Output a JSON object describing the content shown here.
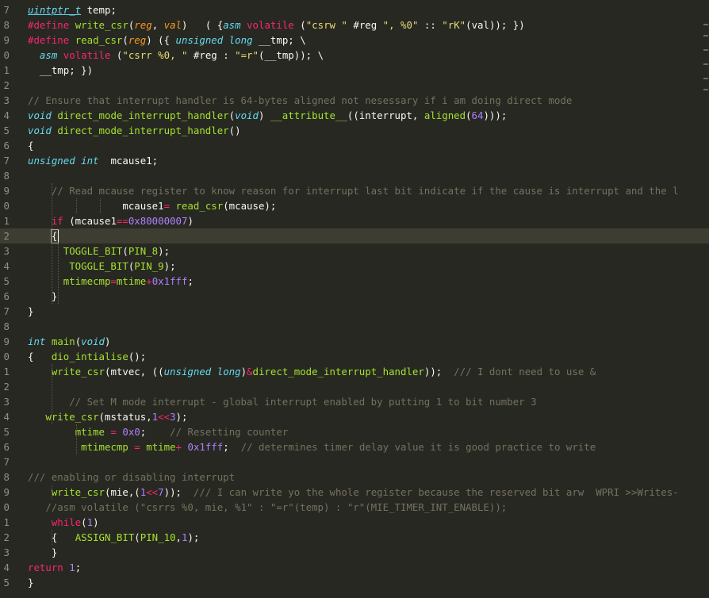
{
  "editor": {
    "theme_background": "#272822",
    "active_line_background": "#3e3d32",
    "colors": {
      "keyword": "#f92672",
      "type": "#66d9ef",
      "function": "#a6e22e",
      "string": "#e6db74",
      "number": "#ae81ff",
      "comment": "#75715e",
      "parameter": "#fd971f",
      "plain": "#f8f8f2"
    },
    "active_line_number": "21",
    "lines": [
      {
        "num": "7",
        "tokens": [
          [
            "t u",
            "uintptr_t"
          ],
          [
            "",
            " temp;"
          ]
        ]
      },
      {
        "num": "8",
        "tokens": [
          [
            "k",
            "#define"
          ],
          [
            "",
            " "
          ],
          [
            "f",
            "write_csr"
          ],
          [
            "",
            "("
          ],
          [
            "p",
            "reg"
          ],
          [
            "",
            ", "
          ],
          [
            "p",
            "val"
          ],
          [
            "",
            ")   ( {"
          ],
          [
            "t",
            "asm"
          ],
          [
            "",
            " "
          ],
          [
            "k",
            "volatile"
          ],
          [
            "",
            " ("
          ],
          [
            "s",
            "\"csrw \""
          ],
          [
            "",
            " #reg "
          ],
          [
            "s",
            "\", %0\""
          ],
          [
            "",
            " :: "
          ],
          [
            "s",
            "\"rK\""
          ],
          [
            "",
            "(val)); })"
          ]
        ]
      },
      {
        "num": "9",
        "tokens": [
          [
            "k",
            "#define"
          ],
          [
            "",
            " "
          ],
          [
            "f",
            "read_csr"
          ],
          [
            "",
            "("
          ],
          [
            "p",
            "reg"
          ],
          [
            "",
            ") ({ "
          ],
          [
            "t",
            "unsigned long"
          ],
          [
            "",
            " __tmp; \\"
          ]
        ]
      },
      {
        "num": "0",
        "tokens": [
          [
            "",
            "  "
          ],
          [
            "t",
            "asm"
          ],
          [
            "",
            " "
          ],
          [
            "k",
            "volatile"
          ],
          [
            "",
            " ("
          ],
          [
            "s",
            "\"csrr %0, \""
          ],
          [
            "",
            " #reg : "
          ],
          [
            "s",
            "\"=r\""
          ],
          [
            "",
            "(__tmp)); \\"
          ]
        ]
      },
      {
        "num": "1",
        "tokens": [
          [
            "",
            "  __tmp; })"
          ]
        ]
      },
      {
        "num": "2",
        "tokens": []
      },
      {
        "num": "3",
        "tokens": [
          [
            "c",
            "// Ensure that interrupt handler is 64-bytes aligned not nesessary if i am doing direct mode"
          ]
        ]
      },
      {
        "num": "4",
        "tokens": [
          [
            "t",
            "void"
          ],
          [
            "",
            " "
          ],
          [
            "f",
            "direct_mode_interrupt_handler"
          ],
          [
            "",
            "("
          ],
          [
            "t",
            "void"
          ],
          [
            "",
            ") "
          ],
          [
            "f",
            "__attribute__"
          ],
          [
            "",
            "((interrupt, "
          ],
          [
            "f",
            "aligned"
          ],
          [
            "",
            "("
          ],
          [
            "n",
            "64"
          ],
          [
            "",
            ")));"
          ]
        ]
      },
      {
        "num": "5",
        "tokens": [
          [
            "t",
            "void"
          ],
          [
            "",
            " "
          ],
          [
            "f",
            "direct_mode_interrupt_handler"
          ],
          [
            "",
            "()"
          ]
        ]
      },
      {
        "num": "6",
        "tokens": [
          [
            "",
            "{"
          ]
        ]
      },
      {
        "num": "7",
        "tokens": [
          [
            "t",
            "unsigned int"
          ],
          [
            "",
            "  mcause1;"
          ]
        ]
      },
      {
        "num": "8",
        "tokens": []
      },
      {
        "num": "9",
        "tokens": [
          [
            "",
            "    "
          ],
          [
            "c",
            "// Read mcause register to know reason for interrupt last bit indicate if the cause is interrupt and the l"
          ]
        ]
      },
      {
        "num": "0",
        "tokens": [
          [
            "",
            "                "
          ],
          [
            "",
            "mcause1"
          ],
          [
            "o",
            "="
          ],
          [
            "",
            " "
          ],
          [
            "f",
            "read_csr"
          ],
          [
            "",
            "(mcause);"
          ]
        ]
      },
      {
        "num": "1",
        "tokens": [
          [
            "",
            "    "
          ],
          [
            "k",
            "if"
          ],
          [
            "",
            " (mcause1"
          ],
          [
            "o",
            "=="
          ],
          [
            "n",
            "0x80000007"
          ],
          [
            "",
            ")"
          ]
        ]
      },
      {
        "num": "2",
        "tokens": [
          [
            "",
            "    {"
          ]
        ],
        "active": true
      },
      {
        "num": "3",
        "tokens": [
          [
            "",
            "      "
          ],
          [
            "f",
            "TOGGLE_BIT"
          ],
          [
            "",
            "("
          ],
          [
            "f",
            "PIN_8"
          ],
          [
            "",
            ");"
          ]
        ]
      },
      {
        "num": "4",
        "tokens": [
          [
            "",
            "       "
          ],
          [
            "f",
            "TOGGLE_BIT"
          ],
          [
            "",
            "("
          ],
          [
            "f",
            "PIN_9"
          ],
          [
            "",
            ");"
          ]
        ]
      },
      {
        "num": "5",
        "tokens": [
          [
            "",
            "      "
          ],
          [
            "f",
            "mtimecmp"
          ],
          [
            "o",
            "="
          ],
          [
            "f",
            "mtime"
          ],
          [
            "o",
            "+"
          ],
          [
            "n",
            "0x1fff"
          ],
          [
            "",
            ";"
          ]
        ]
      },
      {
        "num": "6",
        "tokens": [
          [
            "",
            "    }"
          ]
        ]
      },
      {
        "num": "7",
        "tokens": [
          [
            "",
            "}"
          ]
        ]
      },
      {
        "num": "8",
        "tokens": []
      },
      {
        "num": "9",
        "tokens": [
          [
            "t",
            "int"
          ],
          [
            "",
            " "
          ],
          [
            "f",
            "main"
          ],
          [
            "",
            "("
          ],
          [
            "t",
            "void"
          ],
          [
            "",
            ")"
          ]
        ]
      },
      {
        "num": "0",
        "tokens": [
          [
            "",
            "{   "
          ],
          [
            "f",
            "dio_intialise"
          ],
          [
            "",
            "();"
          ]
        ]
      },
      {
        "num": "1",
        "tokens": [
          [
            "",
            "    "
          ],
          [
            "f",
            "write_csr"
          ],
          [
            "",
            "(mtvec, (("
          ],
          [
            "t",
            "unsigned long"
          ],
          [
            "",
            ")"
          ],
          [
            "o",
            "&"
          ],
          [
            "f",
            "direct_mode_interrupt_handler"
          ],
          [
            "",
            "));  "
          ],
          [
            "c",
            "/// I dont need to use &"
          ]
        ]
      },
      {
        "num": "2",
        "tokens": []
      },
      {
        "num": "3",
        "tokens": [
          [
            "",
            "       "
          ],
          [
            "c",
            "// Set M mode interrupt - global interrupt enabled by putting 1 to bit number 3"
          ]
        ]
      },
      {
        "num": "4",
        "tokens": [
          [
            "",
            "   "
          ],
          [
            "f",
            "write_csr"
          ],
          [
            "",
            "(mstatus,"
          ],
          [
            "n",
            "1"
          ],
          [
            "o",
            "<<"
          ],
          [
            "n",
            "3"
          ],
          [
            "",
            ");"
          ]
        ]
      },
      {
        "num": "5",
        "tokens": [
          [
            "",
            "        "
          ],
          [
            "f",
            "mtime"
          ],
          [
            "",
            " "
          ],
          [
            "o",
            "="
          ],
          [
            "",
            " "
          ],
          [
            "n",
            "0x0"
          ],
          [
            "",
            ";    "
          ],
          [
            "c",
            "// Resetting counter"
          ]
        ]
      },
      {
        "num": "6",
        "tokens": [
          [
            "",
            "         "
          ],
          [
            "f",
            "mtimecmp"
          ],
          [
            "",
            " "
          ],
          [
            "o",
            "="
          ],
          [
            "",
            " "
          ],
          [
            "f",
            "mtime"
          ],
          [
            "o",
            "+"
          ],
          [
            "",
            " "
          ],
          [
            "n",
            "0x1fff"
          ],
          [
            "",
            ";  "
          ],
          [
            "c",
            "// determines timer delay value it is good practice to write"
          ]
        ]
      },
      {
        "num": "7",
        "tokens": []
      },
      {
        "num": "8",
        "tokens": [
          [
            "c",
            "/// enabling or disabling interrupt"
          ]
        ]
      },
      {
        "num": "9",
        "tokens": [
          [
            "",
            "    "
          ],
          [
            "f",
            "write_csr"
          ],
          [
            "",
            "(mie,("
          ],
          [
            "n",
            "1"
          ],
          [
            "o",
            "<<"
          ],
          [
            "n",
            "7"
          ],
          [
            "",
            "));  "
          ],
          [
            "c",
            "/// I can write yo the whole register because the reserved bit arw  WPRI >>Writes-"
          ]
        ]
      },
      {
        "num": "0",
        "tokens": [
          [
            "",
            "   "
          ],
          [
            "c",
            "//asm volatile (\"csrrs %0, mie, %1\" : \"=r\"(temp) : \"r\"(MIE_TIMER_INT_ENABLE));"
          ]
        ]
      },
      {
        "num": "1",
        "tokens": [
          [
            "",
            "    "
          ],
          [
            "k",
            "while"
          ],
          [
            "",
            "("
          ],
          [
            "n",
            "1"
          ],
          [
            "",
            ")"
          ]
        ]
      },
      {
        "num": "2",
        "tokens": [
          [
            "",
            "    {   "
          ],
          [
            "f",
            "ASSIGN_BIT"
          ],
          [
            "",
            "("
          ],
          [
            "f",
            "PIN_10"
          ],
          [
            "",
            ","
          ],
          [
            "n",
            "1"
          ],
          [
            "",
            ");"
          ]
        ]
      },
      {
        "num": "3",
        "tokens": [
          [
            "",
            "    }"
          ]
        ]
      },
      {
        "num": "4",
        "tokens": [
          [
            "k",
            "return"
          ],
          [
            "",
            " "
          ],
          [
            "n",
            "1"
          ],
          [
            "",
            ";"
          ]
        ]
      },
      {
        "num": "5",
        "tokens": [
          [
            "",
            "}"
          ]
        ]
      }
    ]
  }
}
